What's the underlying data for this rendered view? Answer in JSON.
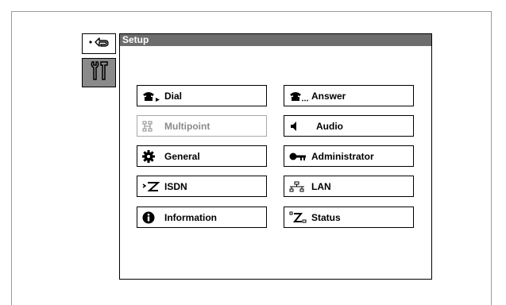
{
  "panel": {
    "title": "Setup"
  },
  "side": [
    {
      "name": "back-button",
      "icon": "return-arrow-icon"
    },
    {
      "name": "setup-tools-button",
      "icon": "tools-icon",
      "selected": true
    }
  ],
  "menu": {
    "left": [
      {
        "label": "Dial",
        "icon": "phone-dial-icon",
        "enabled": true
      },
      {
        "label": "Multipoint",
        "icon": "multipoint-icon",
        "enabled": false
      },
      {
        "label": "General",
        "icon": "gear-icon",
        "enabled": true
      },
      {
        "label": "ISDN",
        "icon": "isdn-icon",
        "enabled": true
      },
      {
        "label": "Information",
        "icon": "info-icon",
        "enabled": true
      }
    ],
    "right": [
      {
        "label": "Answer",
        "icon": "phone-answer-icon",
        "enabled": true
      },
      {
        "label": "Audio",
        "icon": "speaker-icon",
        "enabled": true
      },
      {
        "label": "Administrator",
        "icon": "key-icon",
        "enabled": true
      },
      {
        "label": "LAN",
        "icon": "lan-icon",
        "enabled": true
      },
      {
        "label": "Status",
        "icon": "status-icon",
        "enabled": true
      }
    ]
  },
  "colors": {
    "titlebar": "#6d6d6d",
    "selected": "#8a8a8a",
    "disabled": "#8a8a8a"
  }
}
